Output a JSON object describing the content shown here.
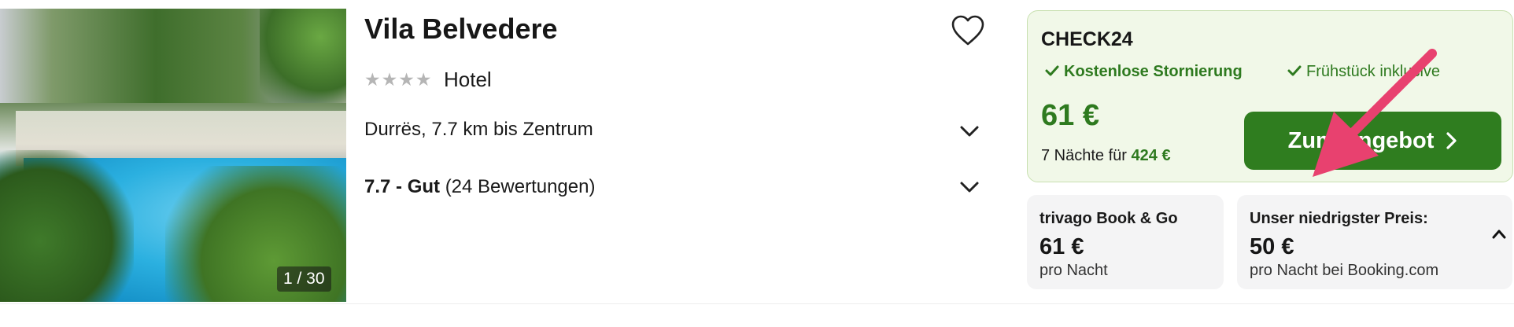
{
  "hotel": {
    "photo_counter": "1 / 30",
    "name": "Vila Belvedere",
    "stars_glyphs": "★★★★",
    "type": "Hotel",
    "location": "Durrës, 7.7 km bis Zentrum",
    "rating_score": "7.7 - Gut",
    "rating_count": "(24 Bewertungen)"
  },
  "deal": {
    "provider": "CHECK24",
    "feature_1": "Kostenlose Stornierung",
    "feature_2": "Frühstück inklusive",
    "price": "61 €",
    "nights_prefix": "7 Nächte für",
    "nights_total": "424 €",
    "cta_label": "Zum Angebot"
  },
  "alt_offers": [
    {
      "label": "trivago Book & Go",
      "price": "61 €",
      "sub": "pro Nacht"
    },
    {
      "label": "Unser niedrigster Preis:",
      "price": "50 €",
      "sub": "pro Nacht bei Booking.com"
    }
  ],
  "icons": {
    "favorite": "heart-outline-icon",
    "expand": "chevron-down-icon",
    "collapse": "chevron-up-icon",
    "check": "checkmark-icon",
    "next": "chevron-right-icon"
  },
  "colors": {
    "accent_green": "#2f7d1f",
    "deal_background": "#f1f8e8",
    "annotation_arrow": "#e8416f"
  }
}
